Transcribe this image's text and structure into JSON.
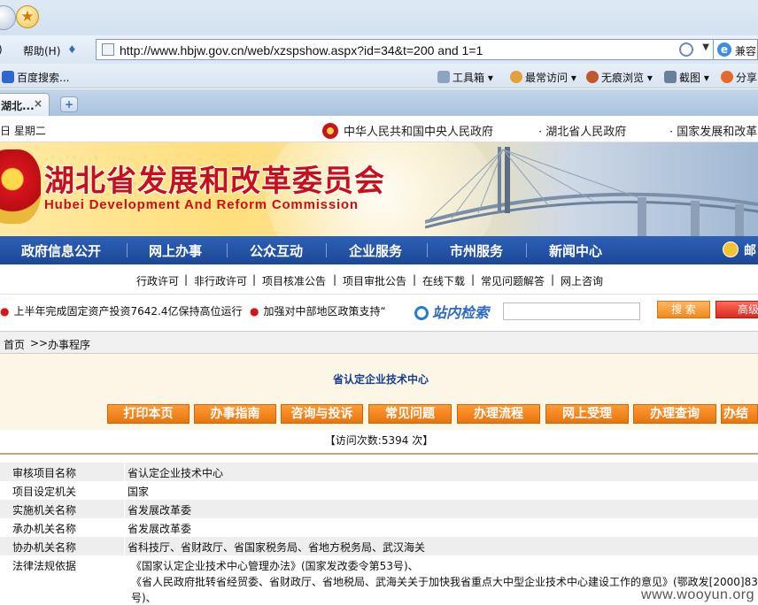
{
  "browser": {
    "menu_help": "帮助(H)",
    "address_url": "http://www.hbjw.gov.cn/web/xzspshow.aspx?id=34&t=200 and 1=1",
    "compat_label": "兼容",
    "baidu_search": "百度搜索...",
    "toolbar": [
      "工具箱",
      "最常访问",
      "无痕浏览",
      "截图",
      "分享"
    ],
    "tab_title": "湖北...",
    "tab_close": "×",
    "new_tab": "+"
  },
  "header": {
    "date": "日 星期二",
    "gov_links": [
      "中华人民共和国中央人民政府",
      "· 湖北省人民政府",
      "· 国家发展和改革"
    ],
    "title_cn": "湖北省发展和改革委员会",
    "title_en": "Hubei Development And Reform Commission"
  },
  "main_nav": [
    "政府信息公开",
    "网上办事",
    "公众互动",
    "企业服务",
    "市州服务",
    "新闻中心"
  ],
  "main_nav_mail": "邮",
  "sub_nav": [
    "行政许可",
    "非行政许可",
    "项目核准公告",
    "项目审批公告",
    "在线下载",
    "常见问题解答",
    "网上咨询"
  ],
  "news": {
    "item1": "上半年完成固定资产投资7642.4亿保持高位运行",
    "item2": "加强对中部地区政策支持“",
    "site_search_label": "站内检索",
    "search_button": "搜 索",
    "advanced_button": "高级"
  },
  "breadcrumb": {
    "home": "首页",
    "sep": ">>",
    "current": "办事程序"
  },
  "panel": {
    "title": "省认定企业技术中心",
    "buttons": [
      "打印本页",
      "办事指南",
      "咨询与投诉",
      "常见问题",
      "办理流程",
      "网上受理",
      "办理查询",
      "办结"
    ]
  },
  "visits": "【访问次数:5394 次】",
  "rows": [
    {
      "label": "审核项目名称",
      "value": "省认定企业技术中心"
    },
    {
      "label": "项目设定机关",
      "value": "国家"
    },
    {
      "label": "实施机关名称",
      "value": "省发展改革委"
    },
    {
      "label": "承办机关名称",
      "value": "省发展改革委"
    },
    {
      "label": "协办机关名称",
      "value": "省科技厅、省财政厅、省国家税务局、省地方税务局、武汉海关"
    }
  ],
  "legal": {
    "label": "法律法规依据",
    "lines": [
      "《国家认定企业技术中心管理办法》(国家发改委令第53号)、",
      "《省人民政府批转省经贸委、省财政厅、省地税局、武海关关于加快我省重点大中型企业技术中心建设工作的意见》(鄂政发[2000]83",
      "号)、"
    ]
  },
  "watermark": "www.wooyun.org"
}
